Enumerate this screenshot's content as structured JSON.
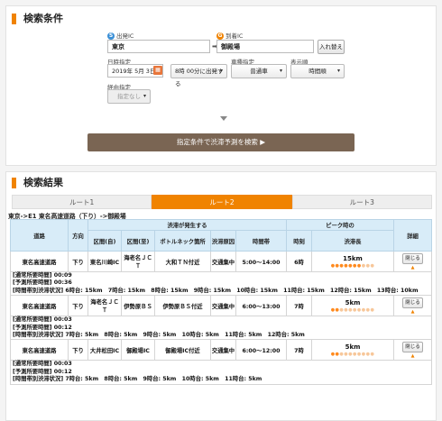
{
  "conditions": {
    "title": "検索条件",
    "start_ic_label": "出発IC",
    "start_ic_icon": "S",
    "start_ic_value": "東京",
    "goal_ic_label": "到着IC",
    "goal_ic_icon": "G",
    "goal_ic_value": "御殿場",
    "swap_label": "入れ替え",
    "datetime_label": "日時指定",
    "date_value": "2019年 5月 3日",
    "calendar_icon": "calendar-icon",
    "time_value": "8時 00分に出発する",
    "vehicle_label": "車種指定",
    "vehicle_value": "普通車",
    "display_label": "表示順",
    "display_value": "時間順",
    "via_label": "経由指定",
    "via_value": "指定なし",
    "search_button": "指定条件で渋滞予測を検索 ▶"
  },
  "results": {
    "title": "検索結果",
    "tabs": [
      "ルート1",
      "ルート2",
      "ルート3"
    ],
    "active_tab": 1,
    "route_text": "東京->E1 東名高速道路（下り）->御殿場",
    "headers": {
      "road": "道路",
      "direction": "方向",
      "congestion": "渋滞が発生する",
      "from": "区間(自)",
      "to": "区間(至)",
      "bottleneck": "ボトルネック箇所",
      "cause": "渋滞原因",
      "time": "時間帯",
      "peak": "ピーク時の",
      "peak_hour": "時刻",
      "peak_len": "渋滞長",
      "detail": "詳細"
    },
    "rows": [
      {
        "road": "東名高速道路",
        "direction": "下り",
        "from": "東名川崎IC",
        "to": "海老名ＪＣＴ",
        "bottleneck": "大和ＴＮ付近",
        "cause": "交通集中",
        "time": "5:00～14:00",
        "peak_hour": "6時",
        "peak_len": "15km",
        "close": "閉じる",
        "info": [
          "[通常所要時間] 00:09",
          "[予測所要時間] 00:36",
          "[時間帯別渋滞状況] 6時台: 15km　7時台: 15km　8時台: 15km　9時台: 15km　10時台: 15km　11時台: 15km　12時台: 15km　13時台: 10km"
        ]
      },
      {
        "road": "東名高速道路",
        "direction": "下り",
        "from": "海老名ＪＣＴ",
        "to": "伊勢原ＢＳ",
        "bottleneck": "伊勢原ＢＳ付近",
        "cause": "交通集中",
        "time": "6:00～13:00",
        "peak_hour": "7時",
        "peak_len": "5km",
        "close": "閉じる",
        "info": [
          "[通常所要時間] 00:03",
          "[予測所要時間] 00:12",
          "[時間帯別渋滞状況] 7時台: 5km　8時台: 5km　9時台: 5km　10時台: 5km　11時台: 5km　12時台: 5km"
        ]
      },
      {
        "road": "東名高速道路",
        "direction": "下り",
        "from": "大井松田IC",
        "to": "御殿場IC",
        "bottleneck": "御殿場IC付近",
        "cause": "交通集中",
        "time": "6:00～12:00",
        "peak_hour": "7時",
        "peak_len": "5km",
        "close": "閉じる",
        "info": [
          "[通常所要時間] 00:03",
          "[予測所要時間] 00:12",
          "[時間帯別渋滞状況] 7時台: 5km　8時台: 5km　9時台: 5km　10時台: 5km　11時台: 5km"
        ]
      }
    ]
  }
}
